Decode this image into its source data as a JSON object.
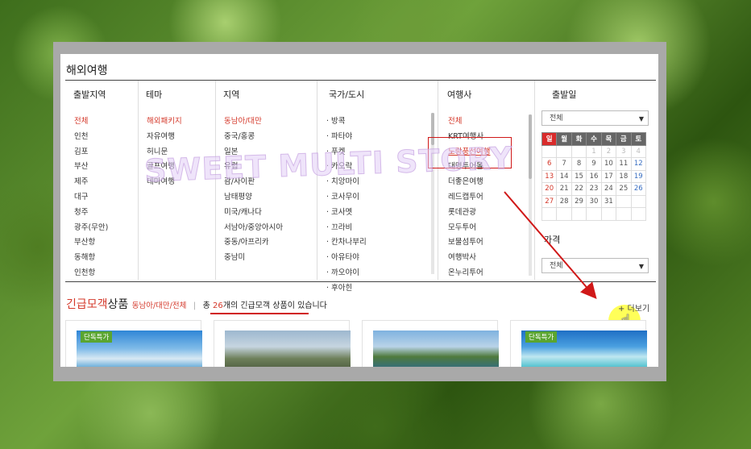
{
  "page_title": "해외여행",
  "columns": {
    "departure": {
      "header": "출발지역",
      "items": [
        "전체",
        "인천",
        "김포",
        "부산",
        "제주",
        "대구",
        "청주",
        "광주(무안)",
        "부산항",
        "동해항",
        "인천항"
      ]
    },
    "theme": {
      "header": "테마",
      "items": [
        "해외패키지",
        "자유여행",
        "허니문",
        "골프여행",
        "테마여행"
      ]
    },
    "region": {
      "header": "지역",
      "items": [
        "동남아/대만",
        "중국/홍콩",
        "일본",
        "유럽",
        "괌/사이판",
        "남태평양",
        "미국/캐나다",
        "서남아/중앙아시아",
        "중동/아프리카",
        "중남미"
      ]
    },
    "country": {
      "header": "국가/도시",
      "items": [
        "· 방콕",
        "· 파타야",
        "· 푸켓",
        "· 카오락",
        "· 치앙마이",
        "· 코사무이",
        "· 코사멧",
        "· 끄라비",
        "· 칸차나부리",
        "· 아유타야",
        "· 까오야이",
        "· 후아힌"
      ]
    },
    "agency": {
      "header": "여행사",
      "items": [
        "전체",
        "KRT여행사",
        "노랑풍선여행",
        "대명투어몰",
        "더좋은여행",
        "레드캡투어",
        "롯데관광",
        "모두투어",
        "보물섬투어",
        "여행박사",
        "온누리투어"
      ]
    }
  },
  "departure_date": {
    "header": "출발일",
    "select_value": "전체",
    "weekdays": [
      "일",
      "월",
      "화",
      "수",
      "목",
      "금",
      "토"
    ],
    "weeks": [
      [
        "",
        "",
        "",
        "",
        "",
        "",
        ""
      ],
      [
        "",
        "",
        "",
        "1",
        "2",
        "3",
        "4"
      ],
      [
        "6",
        "7",
        "8",
        "9",
        "10",
        "11",
        "12"
      ],
      [
        "13",
        "14",
        "15",
        "16",
        "17",
        "18",
        "19"
      ],
      [
        "20",
        "21",
        "22",
        "23",
        "24",
        "25",
        "26"
      ],
      [
        "27",
        "28",
        "29",
        "30",
        "31",
        "",
        ""
      ],
      [
        "",
        "",
        "",
        "",
        "",
        "",
        ""
      ]
    ],
    "week_row2_first": "",
    "dim_days": [
      "1",
      "2",
      "3",
      "4"
    ]
  },
  "price": {
    "header": "가격",
    "select_value": "전체"
  },
  "bottom": {
    "title_red": "긴급모객",
    "title_dark": "상품",
    "subtitle": "동남아/대만/전체",
    "bar": "|",
    "count_prefix": "총 ",
    "count_num": "26",
    "count_suffix": "개의 긴급모객 상품이 있습니다",
    "more_label": "+ 더보기"
  },
  "cards": [
    {
      "badge": "단독특가"
    },
    {
      "badge": ""
    },
    {
      "badge": ""
    },
    {
      "badge": "단독특가"
    }
  ],
  "watermark": "SWEET MULTI STORY",
  "colors": {
    "accent_red": "#d4382a",
    "badge_green": "#5aa530",
    "annotation_red": "#d01818",
    "cursor_highlight": "#ffff00"
  },
  "icons": {
    "select_arrow": "chevron-down-icon",
    "cursor": "hand-pointer-icon"
  }
}
